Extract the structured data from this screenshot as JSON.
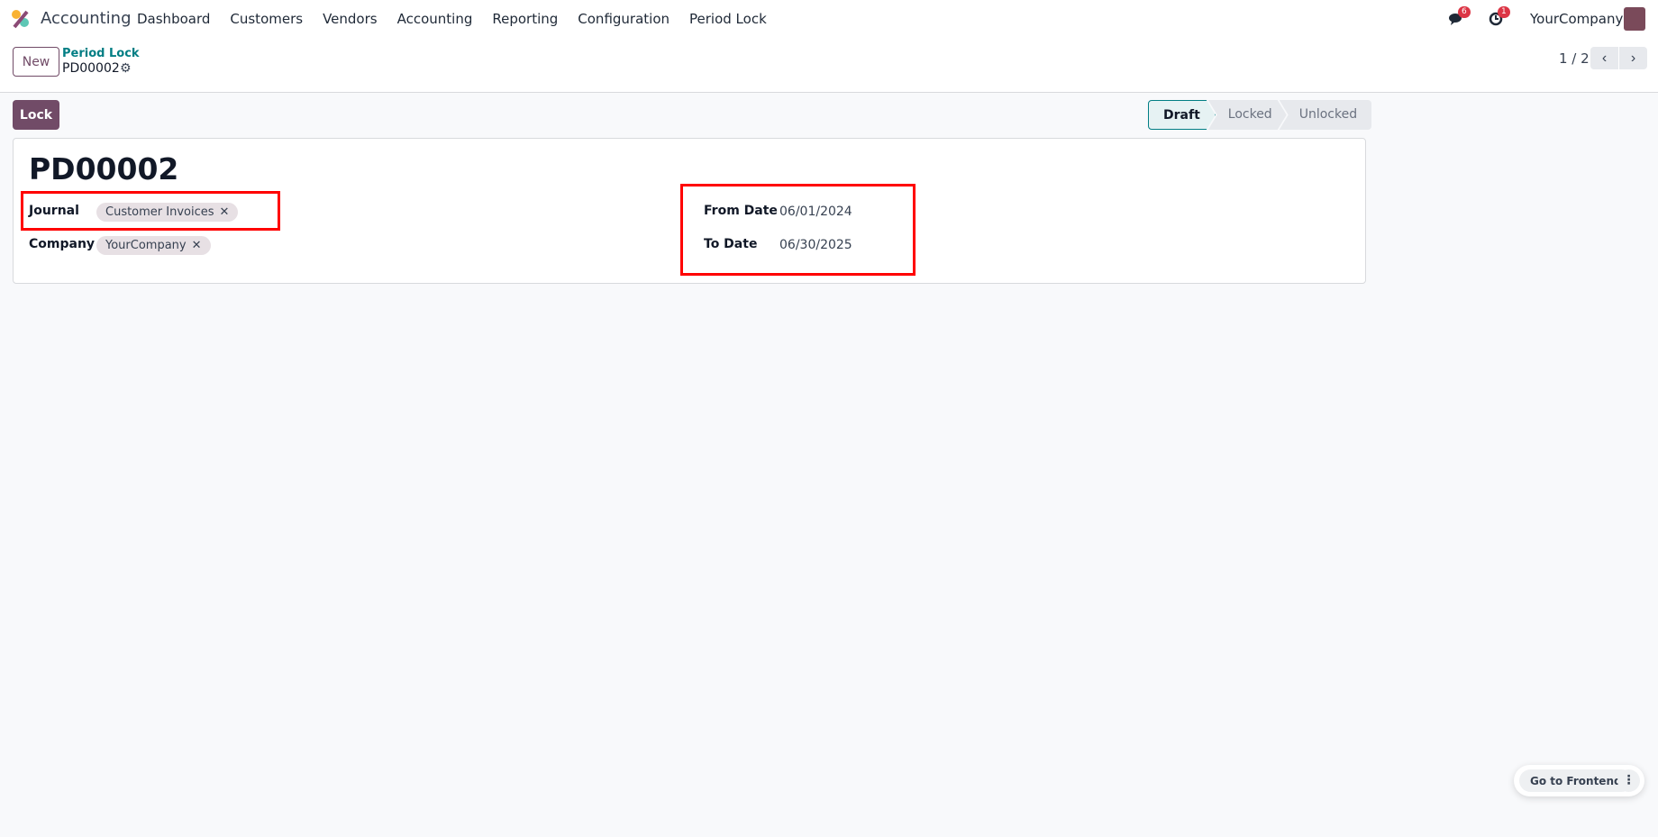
{
  "navbar": {
    "app_name": "Accounting",
    "menu": [
      "Dashboard",
      "Customers",
      "Vendors",
      "Accounting",
      "Reporting",
      "Configuration",
      "Period Lock"
    ],
    "messages_count": "6",
    "activities_count": "1",
    "company": "YourCompany"
  },
  "control_panel": {
    "new_label": "New",
    "breadcrumb_parent": "Period Lock",
    "breadcrumb_current": "PD00002",
    "pager": "1 / 2"
  },
  "actions": {
    "lock_label": "Lock"
  },
  "statusbar": {
    "stages": [
      "Draft",
      "Locked",
      "Unlocked"
    ],
    "active": "Draft"
  },
  "form": {
    "title": "PD00002",
    "journal_label": "Journal",
    "journal_tag": "Customer Invoices",
    "company_label": "Company",
    "company_tag": "YourCompany",
    "from_date_label": "From Date",
    "from_date": "06/01/2024",
    "to_date_label": "To Date",
    "to_date": "06/30/2025"
  },
  "frontend": {
    "label": "Go to Frontend"
  },
  "colors": {
    "brand": "#714b67",
    "accent": "#017e84",
    "highlight": "#ff0000"
  }
}
